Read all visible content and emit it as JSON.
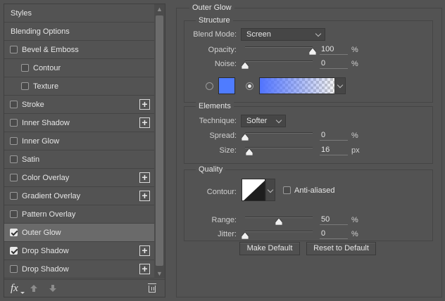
{
  "left": {
    "items": [
      {
        "label": "Styles",
        "checkbox": false,
        "checked": false,
        "indent": false,
        "plus": false,
        "selected": false
      },
      {
        "label": "Blending Options",
        "checkbox": false,
        "checked": false,
        "indent": false,
        "plus": false,
        "selected": false
      },
      {
        "label": "Bevel & Emboss",
        "checkbox": true,
        "checked": false,
        "indent": false,
        "plus": false,
        "selected": false
      },
      {
        "label": "Contour",
        "checkbox": true,
        "checked": false,
        "indent": true,
        "plus": false,
        "selected": false
      },
      {
        "label": "Texture",
        "checkbox": true,
        "checked": false,
        "indent": true,
        "plus": false,
        "selected": false
      },
      {
        "label": "Stroke",
        "checkbox": true,
        "checked": false,
        "indent": false,
        "plus": true,
        "selected": false
      },
      {
        "label": "Inner Shadow",
        "checkbox": true,
        "checked": false,
        "indent": false,
        "plus": true,
        "selected": false
      },
      {
        "label": "Inner Glow",
        "checkbox": true,
        "checked": false,
        "indent": false,
        "plus": false,
        "selected": false
      },
      {
        "label": "Satin",
        "checkbox": true,
        "checked": false,
        "indent": false,
        "plus": false,
        "selected": false
      },
      {
        "label": "Color Overlay",
        "checkbox": true,
        "checked": false,
        "indent": false,
        "plus": true,
        "selected": false
      },
      {
        "label": "Gradient Overlay",
        "checkbox": true,
        "checked": false,
        "indent": false,
        "plus": true,
        "selected": false
      },
      {
        "label": "Pattern Overlay",
        "checkbox": true,
        "checked": false,
        "indent": false,
        "plus": false,
        "selected": false
      },
      {
        "label": "Outer Glow",
        "checkbox": true,
        "checked": true,
        "indent": false,
        "plus": false,
        "selected": true
      },
      {
        "label": "Drop Shadow",
        "checkbox": true,
        "checked": true,
        "indent": false,
        "plus": true,
        "selected": false
      },
      {
        "label": "Drop Shadow",
        "checkbox": true,
        "checked": false,
        "indent": false,
        "plus": true,
        "selected": false
      }
    ],
    "footer": {
      "fx_label": "fx",
      "icons": [
        "fx-icon",
        "move-up-icon",
        "move-down-icon",
        "trash-icon"
      ]
    }
  },
  "panel": {
    "title": "Outer Glow",
    "structure": {
      "title": "Structure",
      "blend_mode_label": "Blend Mode:",
      "blend_mode_value": "Screen",
      "opacity_label": "Opacity:",
      "opacity_value": "100",
      "opacity_unit": "%",
      "opacity_level": 1.0,
      "noise_label": "Noise:",
      "noise_value": "0",
      "noise_unit": "%",
      "noise_level": 0.0,
      "glow_color": "#4f7cff",
      "mode": "gradient"
    },
    "elements": {
      "title": "Elements",
      "technique_label": "Technique:",
      "technique_value": "Softer",
      "spread_label": "Spread:",
      "spread_value": "0",
      "spread_unit": "%",
      "spread_level": 0.0,
      "size_label": "Size:",
      "size_value": "16",
      "size_unit": "px",
      "size_level": 0.064
    },
    "quality": {
      "title": "Quality",
      "contour_label": "Contour:",
      "anti_aliased_label": "Anti-aliased",
      "anti_aliased": false,
      "range_label": "Range:",
      "range_value": "50",
      "range_unit": "%",
      "range_level": 0.5,
      "jitter_label": "Jitter:",
      "jitter_value": "0",
      "jitter_unit": "%",
      "jitter_level": 0.0
    },
    "buttons": {
      "make_default": "Make Default",
      "reset_default": "Reset to Default"
    }
  }
}
